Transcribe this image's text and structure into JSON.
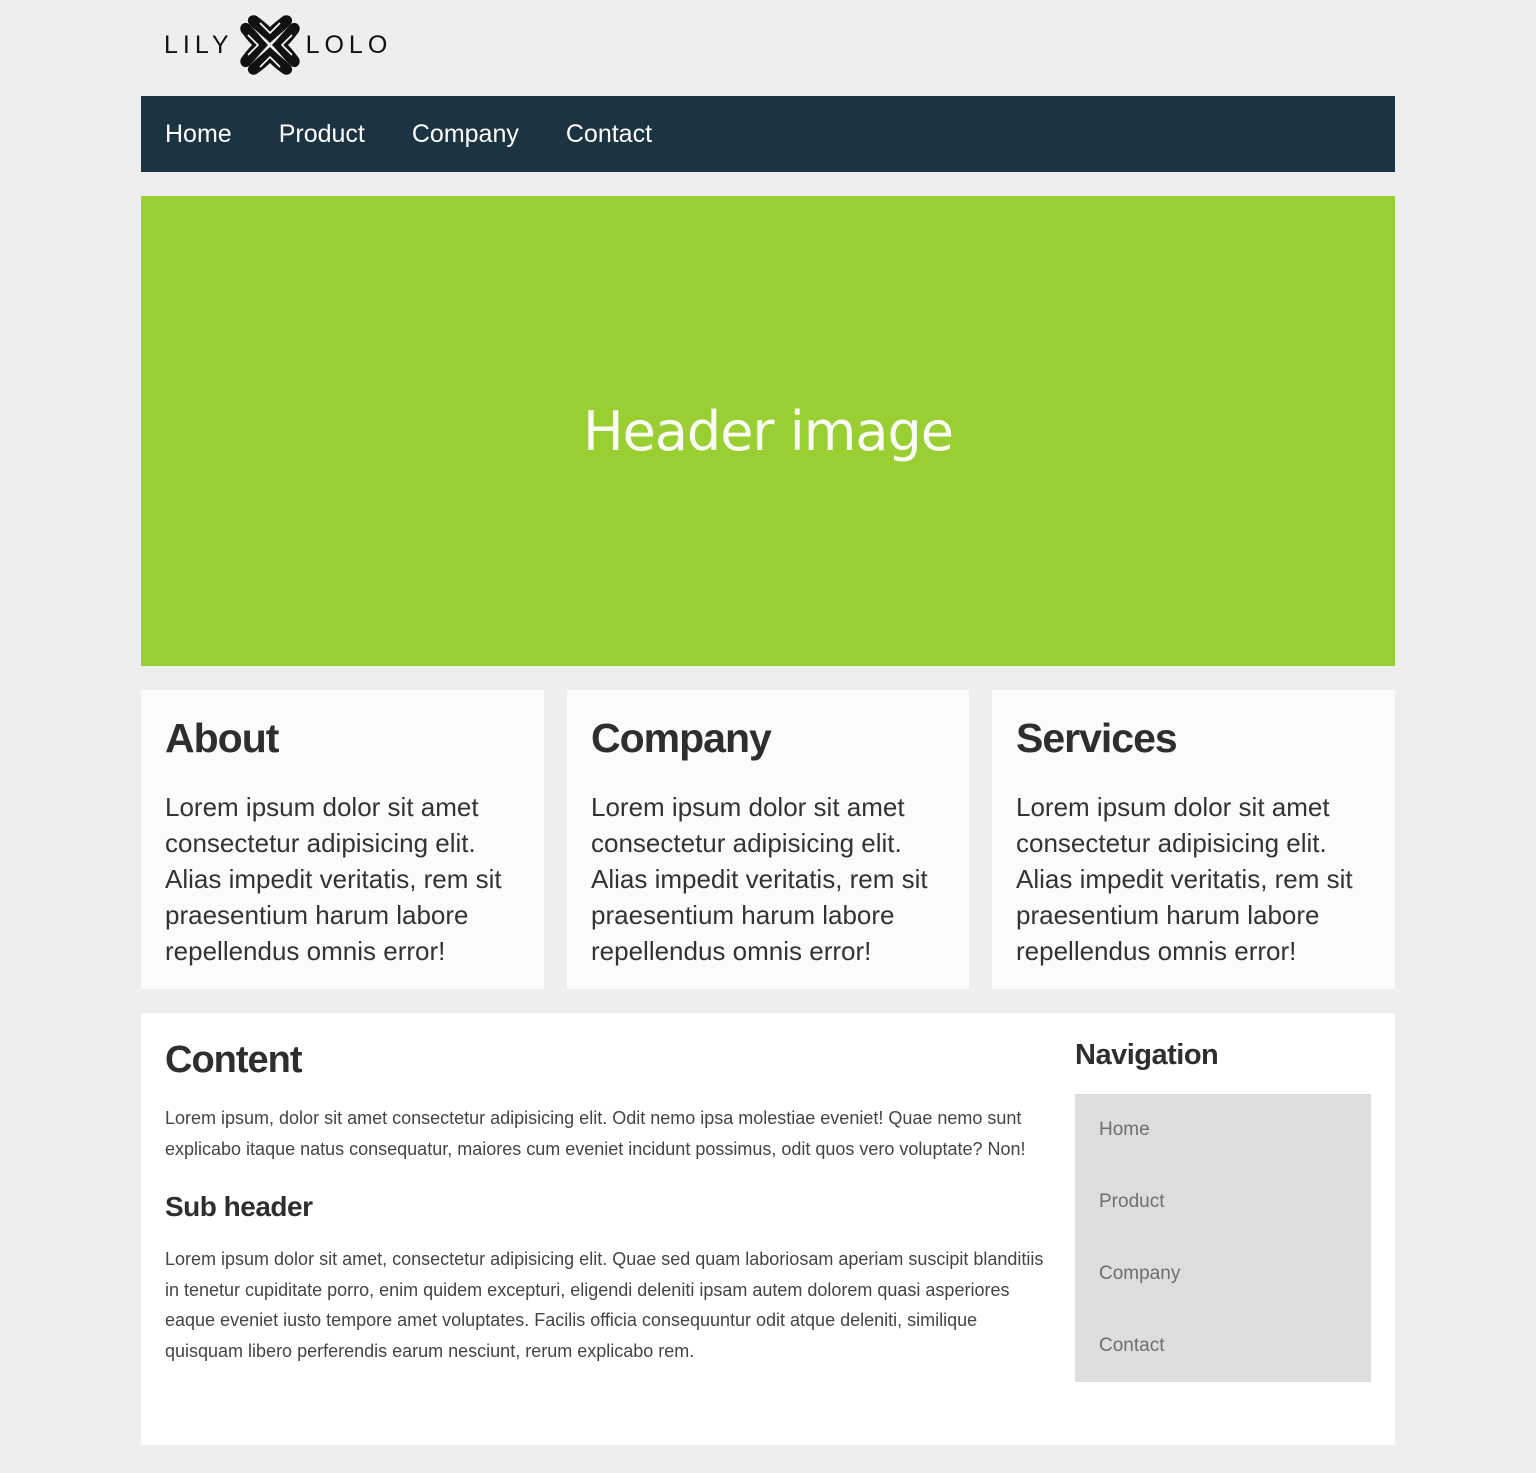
{
  "logo": {
    "left_text": "LILY",
    "right_text": "LOLO",
    "mark_icon": "quatrefoil-hearts-icon"
  },
  "nav": {
    "items": [
      {
        "label": "Home"
      },
      {
        "label": "Product"
      },
      {
        "label": "Company"
      },
      {
        "label": "Contact"
      }
    ],
    "background": "#1c3342"
  },
  "hero": {
    "text": "Header image",
    "background": "#9acf33"
  },
  "features": [
    {
      "title": "About",
      "text": "Lorem ipsum dolor sit amet consectetur adipisicing elit. Alias impedit veritatis, rem sit praesentium harum labore repellendus omnis error!"
    },
    {
      "title": "Company",
      "text": "Lorem ipsum dolor sit amet consectetur adipisicing elit. Alias impedit veritatis, rem sit praesentium harum labore repellendus omnis error!"
    },
    {
      "title": "Services",
      "text": "Lorem ipsum dolor sit amet consectetur adipisicing elit. Alias impedit veritatis, rem sit praesentium harum labore repellendus omnis error!"
    }
  ],
  "content": {
    "title": "Content",
    "paragraph1": "Lorem ipsum, dolor sit amet consectetur adipisicing elit. Odit nemo ipsa molestiae eveniet! Quae nemo sunt explicabo itaque natus consequatur, maiores cum eveniet incidunt possimus, odit quos vero voluptate? Non!",
    "subheader": "Sub header",
    "paragraph2": "Lorem ipsum dolor sit amet, consectetur adipisicing elit. Quae sed quam laboriosam aperiam suscipit blanditiis in tenetur cupiditate porro, enim quidem excepturi, eligendi deleniti ipsam autem dolorem quasi asperiores eaque eveniet iusto tempore amet voluptates. Facilis officia consequuntur odit atque deleniti, similique quisquam libero perferendis earum nesciunt, rerum explicabo rem."
  },
  "sidebar": {
    "title": "Navigation",
    "items": [
      {
        "label": "Home"
      },
      {
        "label": "Product"
      },
      {
        "label": "Company"
      },
      {
        "label": "Contact"
      }
    ]
  }
}
